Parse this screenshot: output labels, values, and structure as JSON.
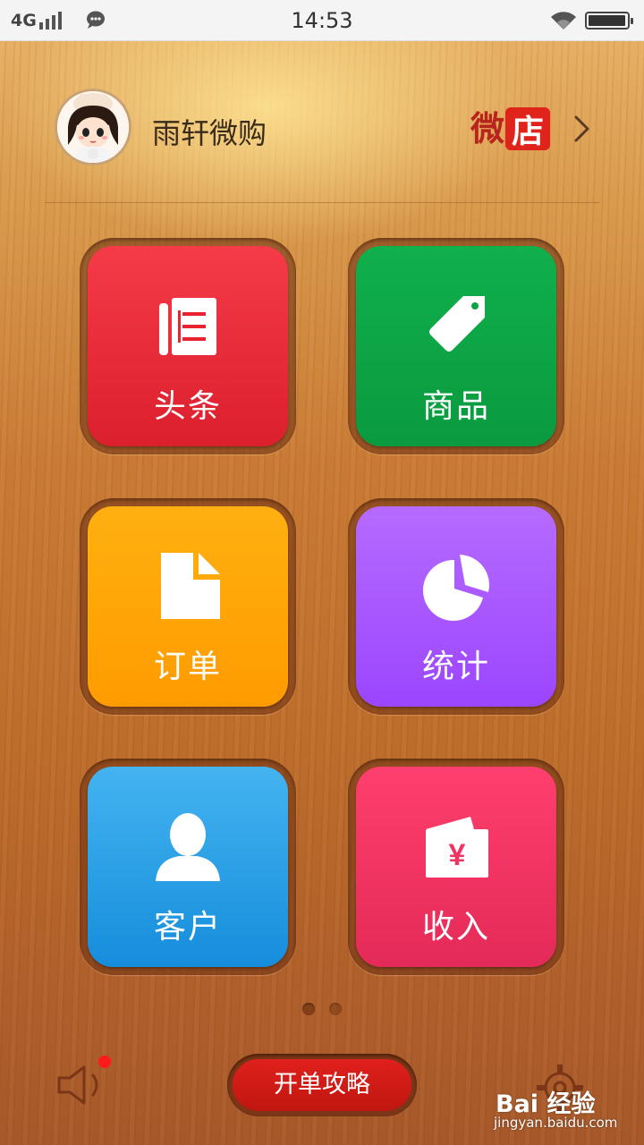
{
  "status_bar": {
    "network": "4G",
    "time": "14:53"
  },
  "header": {
    "shop_name": "雨轩微购",
    "weidian_logo_part1": "微",
    "weidian_logo_part2": "店"
  },
  "tiles": [
    {
      "label": "头条",
      "icon": "news-icon",
      "color": "#e8232f"
    },
    {
      "label": "商品",
      "icon": "tag-icon",
      "color": "#0ba444"
    },
    {
      "label": "订单",
      "icon": "document-icon",
      "color": "#ffa300"
    },
    {
      "label": "统计",
      "icon": "pie-chart-icon",
      "color": "#a553ff"
    },
    {
      "label": "客户",
      "icon": "person-icon",
      "color": "#2b9fe6"
    },
    {
      "label": "收入",
      "icon": "wallet-yen-icon",
      "color": "#f03462"
    }
  ],
  "wallet_symbol": "¥",
  "pager": {
    "pages": 2,
    "current": 1
  },
  "bottom": {
    "guide_button": "开单攻略",
    "notification": true
  },
  "watermark": {
    "logo": "Bai 经验",
    "url": "jingyan.baidu.com"
  }
}
